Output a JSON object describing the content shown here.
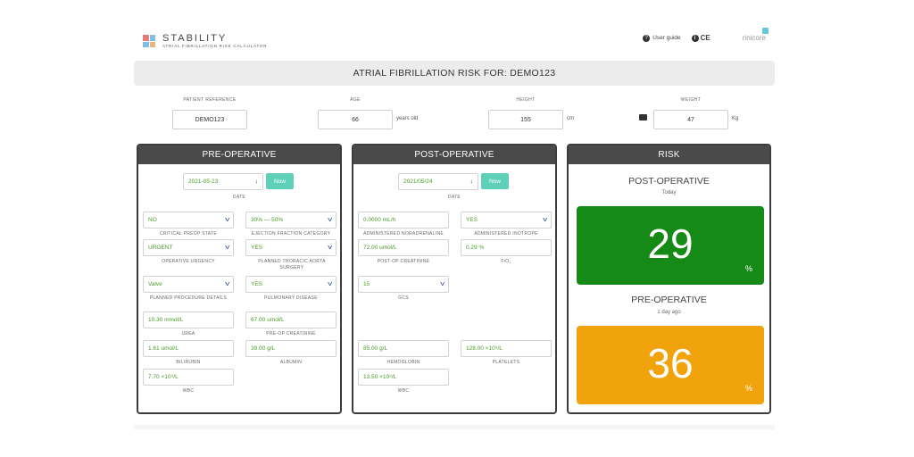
{
  "app": {
    "logo_title": "STABILITY",
    "logo_sub": "ATRIAL FIBRILLATION RISK CALCULATOR",
    "user_guide": "User guide",
    "ce_mark": "CE",
    "brand": "rinicore"
  },
  "title_bar": "ATRIAL FIBRILLATION RISK FOR: DEMO123",
  "patient": {
    "reference_label": "PATIENT REFERENCE",
    "reference_value": "DEMO123",
    "age_label": "AGE",
    "age_value": "66",
    "age_unit": "years old",
    "height_label": "HEIGHT",
    "height_value": "155",
    "height_unit": "cm",
    "weight_label": "WEIGHT",
    "weight_value": "47",
    "weight_unit": "Kg"
  },
  "pre": {
    "header": "PRE-OPERATIVE",
    "date_value": "2021-05-23",
    "now": "Now",
    "date_label": "DATE",
    "critical_value": "NO",
    "critical_label": "CRITICAL PREOP STATE",
    "ef_value": "30% — 50%",
    "ef_label": "EJECTION FRACTION CATEGORY",
    "urgency_value": "URGENT",
    "urgency_label": "OPERATIVE URGENCY",
    "thoracic_value": "YES",
    "thoracic_label": "PLANNED THORACIC AORTA SURGERY",
    "procedure_value": "Valve",
    "procedure_label": "PLANNED PROCEDURE DETAILS",
    "pulmonary_value": "YES",
    "pulmonary_label": "PULMONARY DISEASE",
    "urea_value": "10.30 mmol/L",
    "urea_label": "UREA",
    "creatinine_value": "67.00 umol/L",
    "creatinine_label": "PRE-OP CREATININE",
    "bilirubin_value": "1.61 umol/L",
    "bilirubin_label": "BILIRUBIN",
    "albumin_value": "39.00 g/L",
    "albumin_label": "ALBUMIN",
    "wbc_value": "7.70 ×10⁹/L",
    "wbc_label": "WBC"
  },
  "post": {
    "header": "POST-OPERATIVE",
    "date_value": "2021/05/24",
    "now": "Now",
    "date_label": "DATE",
    "noradrenaline_value": "0.0000 mL/h",
    "noradrenaline_label": "ADMINISTERED NORADRENALINE",
    "inotrope_value": "YES",
    "inotrope_label": "ADMINISTERED INOTROPE",
    "creatinine_value": "72.00 umol/L",
    "creatinine_label": "POST-OP CREATININE",
    "fio2_value": "0.29 %",
    "fio2_label": "FiO₂",
    "gcs_value": "15",
    "gcs_label": "GCS",
    "hemoglobin_value": "85.00 g/L",
    "hemoglobin_label": "HEMOGLOBIN",
    "platelets_value": "128.00 ×10⁹/L",
    "platelets_label": "PLATELETS",
    "wbc_value": "13.50 ×10⁹/L",
    "wbc_label": "WBC"
  },
  "risk": {
    "header": "RISK",
    "post_title": "POST-OPERATIVE",
    "post_when": "Today",
    "post_value": "29",
    "pre_title": "PRE-OPERATIVE",
    "pre_when": "1 day ago",
    "pre_value": "36",
    "percent": "%"
  },
  "colors": {
    "risk_green": "#168a16",
    "risk_orange": "#f0a30a",
    "now_button": "#5fd0b8",
    "field_text": "#4a9a2a",
    "panel_header": "#4a4a4a"
  }
}
